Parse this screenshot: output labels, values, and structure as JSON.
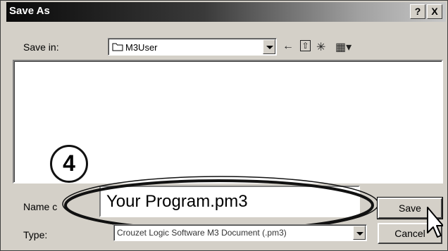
{
  "window": {
    "title": "Save As",
    "help_label": "?",
    "close_label": "X"
  },
  "save_in": {
    "label": "Save in:",
    "value": "M3User",
    "folder_icon": "folder-icon"
  },
  "toolbar": {
    "back_icon": "←",
    "up_icon": "⇧",
    "new_folder_icon": "✳",
    "view_icon": "▦▾"
  },
  "annotation": {
    "step_number": "4"
  },
  "file_name": {
    "label": "Name c",
    "value": "Your Program.pm3"
  },
  "file_type": {
    "label": "Type:",
    "value": "Crouzet Logic Software M3 Document (.pm3)"
  },
  "buttons": {
    "save_label": "Save",
    "cancel_label": "Cancel"
  }
}
